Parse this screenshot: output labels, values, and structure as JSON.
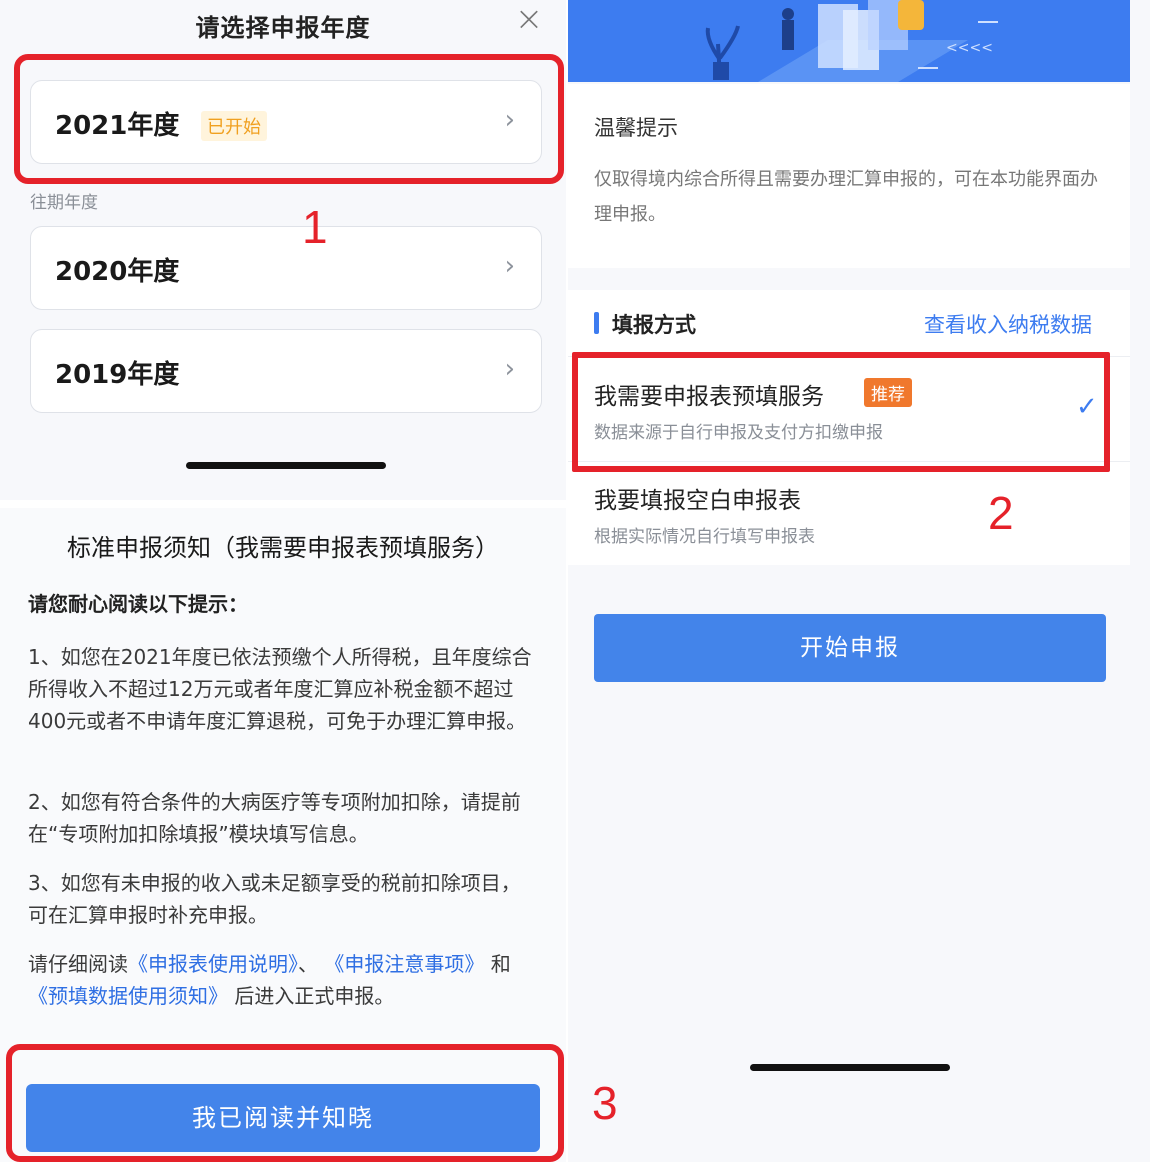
{
  "year_sheet": {
    "title": "请选择申报年度",
    "current_year": {
      "label": "2021年度",
      "badge": "已开始"
    },
    "past_label": "往期年度",
    "past_years": [
      {
        "label": "2020年度"
      },
      {
        "label": "2019年度"
      }
    ]
  },
  "notice": {
    "title": "标准申报须知（我需要申报表预填服务）",
    "subtitle": "请您耐心阅读以下提示：",
    "item1": "1、如您在2021年度已依法预缴个人所得税，且年度综合所得收入不超过12万元或者年度汇算应补税金额不超过400元或者不申请年度汇算退税，可免于办理汇算申报。",
    "item2": "2、如您有符合条件的大病医疗等专项附加扣除，请提前在“专项附加扣除填报”模块填写信息。",
    "item3": "3、如您有未申报的收入或未足额享受的税前扣除项目，可在汇算申报时补充申报。",
    "read_prefix": "请仔细阅读",
    "link1": "《申报表使用说明》",
    "sep1": "、",
    "link2": "《申报注意事项》",
    "sep2": "和",
    "link3": "《预填数据使用须知》",
    "read_suffix": "后进入正式申报。",
    "button": "我已阅读并知晓"
  },
  "right_panel": {
    "tips_title": "温馨提示",
    "tips_text": "仅取得境内综合所得且需要办理汇算申报的，可在本功能界面办理申报。",
    "method_title": "填报方式",
    "method_link": "查看收入纳税数据",
    "options": [
      {
        "title": "我需要申报表预填服务",
        "badge": "推荐",
        "desc": "数据来源于自行申报及支付方扣缴申报",
        "selected": true
      },
      {
        "title": "我要填报空白申报表",
        "desc": "根据实际情况自行填写申报表",
        "selected": false
      }
    ],
    "start_button": "开始申报"
  },
  "annotations": {
    "step1": "1",
    "step2": "2",
    "step3": "3"
  },
  "colors": {
    "accent_blue": "#3d7cf0",
    "button_blue": "#4384ea",
    "annotation_red": "#e5222a",
    "recommend_orange": "#f0782d",
    "badge_yellow": "#f0a020"
  }
}
